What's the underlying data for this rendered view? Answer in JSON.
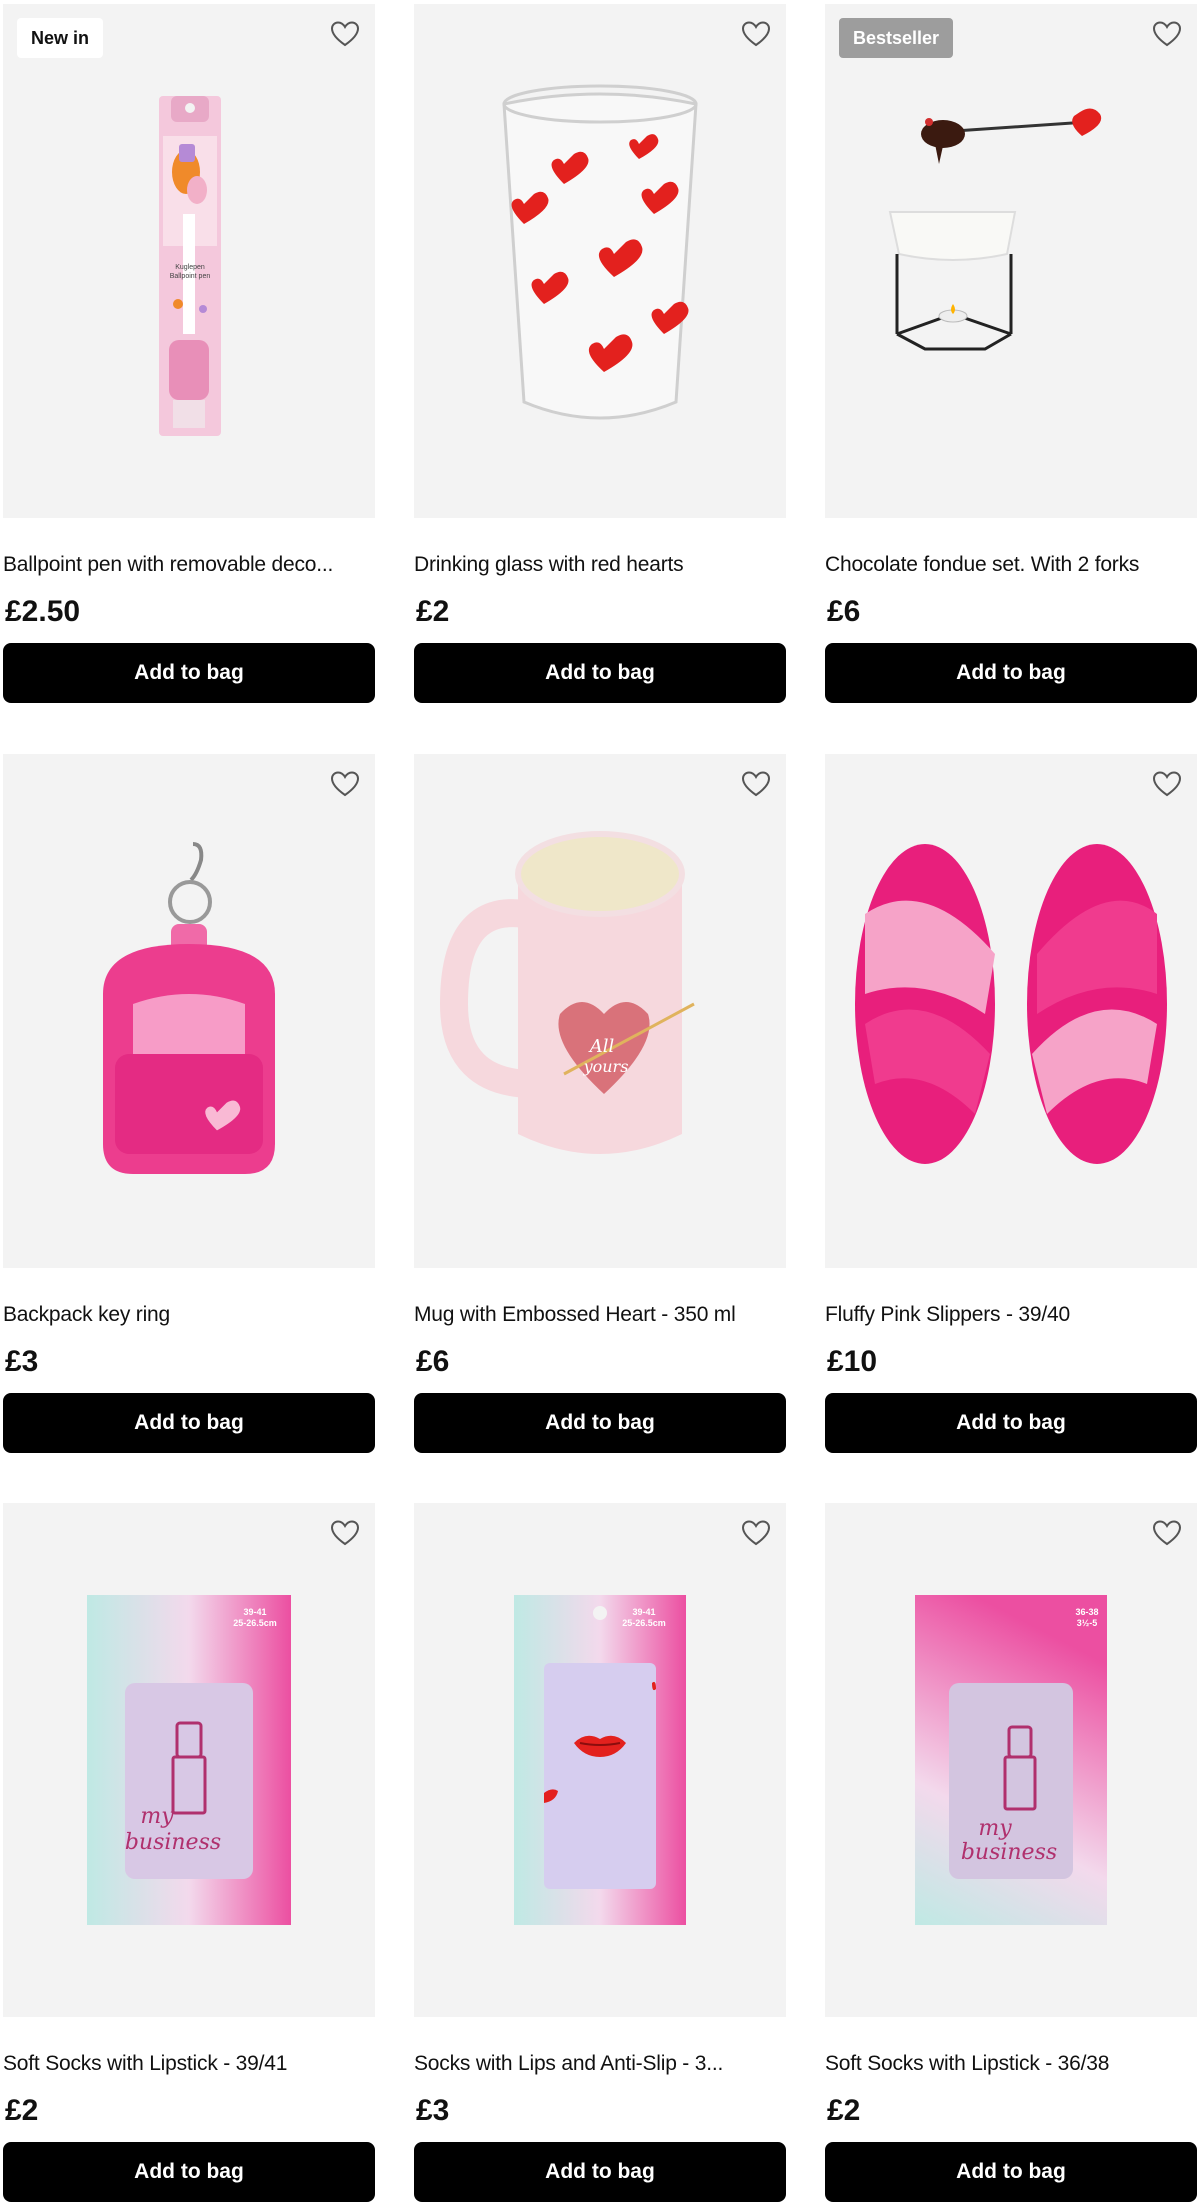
{
  "products": [
    {
      "name": "Ballpoint pen with removable deco...",
      "price": "£2.50",
      "badge": "New in",
      "button": "Add to bag"
    },
    {
      "name": "Drinking glass with red hearts",
      "price": "£2",
      "badge": "",
      "button": "Add to bag"
    },
    {
      "name": "Chocolate fondue set. With 2 forks",
      "price": "£6",
      "badge": "Bestseller",
      "button": "Add to bag"
    },
    {
      "name": "Backpack key ring",
      "price": "£3",
      "badge": "",
      "button": "Add to bag"
    },
    {
      "name": "Mug with Embossed Heart - 350 ml",
      "price": "£6",
      "badge": "",
      "button": "Add to bag"
    },
    {
      "name": "Fluffy Pink Slippers - 39/40",
      "price": "£10",
      "badge": "",
      "button": "Add to bag"
    },
    {
      "name": "Soft Socks with Lipstick - 39/41",
      "price": "£2",
      "badge": "",
      "button": "Add to bag"
    },
    {
      "name": "Socks with Lips and Anti-Slip - 3...",
      "price": "£3",
      "badge": "",
      "button": "Add to bag"
    },
    {
      "name": "Soft Socks with Lipstick - 36/38",
      "price": "£2",
      "badge": "",
      "button": "Add to bag"
    }
  ],
  "package_text": {
    "pen": [
      "Kuglepen",
      "Ballpoint pen"
    ],
    "mug": [
      "All",
      "yours"
    ],
    "sock1_size": [
      "39-41",
      "25-26.5cm"
    ],
    "sock2_size": [
      "39-41",
      "25-26.5cm"
    ],
    "sock3_size": [
      "36-38",
      "3½-5"
    ],
    "sock_slogan": [
      "my",
      "business"
    ]
  },
  "icons": {
    "wishlist": "heart-outline-icon"
  },
  "colors": {
    "button_bg": "#000000",
    "card_bg": "#f3f3f3",
    "bestseller_badge": "#9d9d9d"
  }
}
